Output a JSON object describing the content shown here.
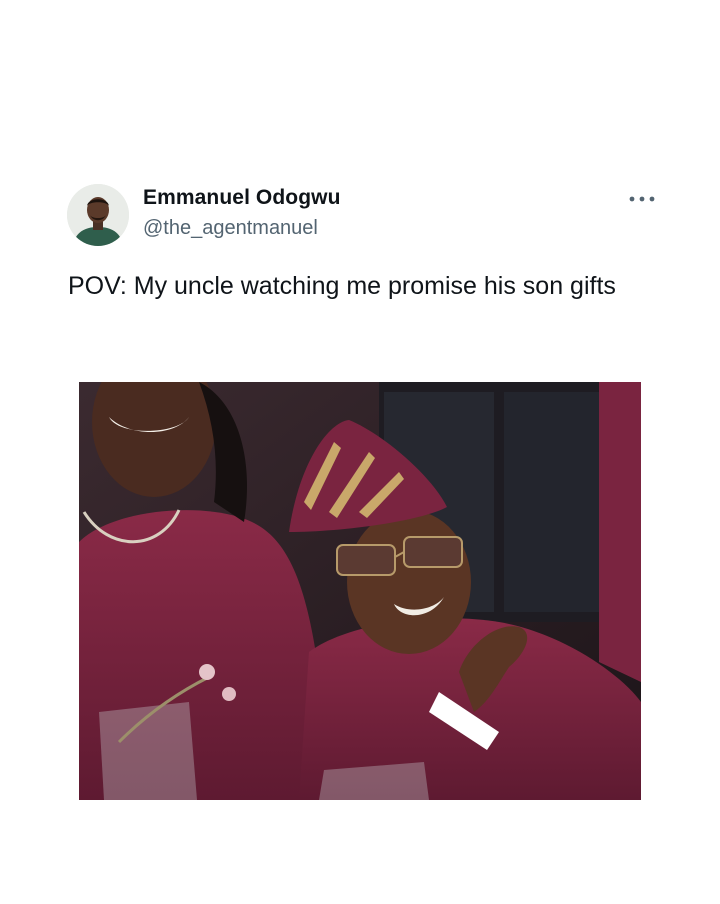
{
  "tweet": {
    "author": {
      "display_name": "Emmanuel Odogwu",
      "handle": "@the_agentmanuel",
      "avatar_icon": "profile-photo"
    },
    "more_icon": "ellipsis-icon",
    "text": "POV: My uncle watching me promise his son gifts",
    "media": {
      "type": "photo",
      "accent_colors": [
        "#6e1f3a",
        "#8a2a47",
        "#2a1b22"
      ]
    }
  }
}
